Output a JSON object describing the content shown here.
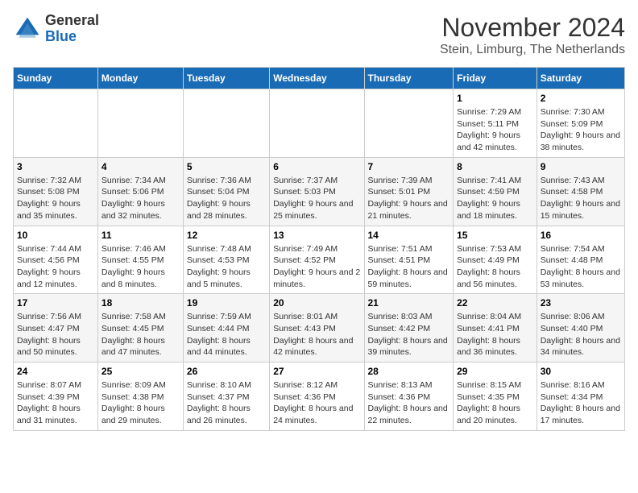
{
  "logo": {
    "line1": "General",
    "line2": "Blue"
  },
  "title": "November 2024",
  "subtitle": "Stein, Limburg, The Netherlands",
  "days_of_week": [
    "Sunday",
    "Monday",
    "Tuesday",
    "Wednesday",
    "Thursday",
    "Friday",
    "Saturday"
  ],
  "weeks": [
    [
      {
        "day": "",
        "info": ""
      },
      {
        "day": "",
        "info": ""
      },
      {
        "day": "",
        "info": ""
      },
      {
        "day": "",
        "info": ""
      },
      {
        "day": "",
        "info": ""
      },
      {
        "day": "1",
        "info": "Sunrise: 7:29 AM\nSunset: 5:11 PM\nDaylight: 9 hours and 42 minutes."
      },
      {
        "day": "2",
        "info": "Sunrise: 7:30 AM\nSunset: 5:09 PM\nDaylight: 9 hours and 38 minutes."
      }
    ],
    [
      {
        "day": "3",
        "info": "Sunrise: 7:32 AM\nSunset: 5:08 PM\nDaylight: 9 hours and 35 minutes."
      },
      {
        "day": "4",
        "info": "Sunrise: 7:34 AM\nSunset: 5:06 PM\nDaylight: 9 hours and 32 minutes."
      },
      {
        "day": "5",
        "info": "Sunrise: 7:36 AM\nSunset: 5:04 PM\nDaylight: 9 hours and 28 minutes."
      },
      {
        "day": "6",
        "info": "Sunrise: 7:37 AM\nSunset: 5:03 PM\nDaylight: 9 hours and 25 minutes."
      },
      {
        "day": "7",
        "info": "Sunrise: 7:39 AM\nSunset: 5:01 PM\nDaylight: 9 hours and 21 minutes."
      },
      {
        "day": "8",
        "info": "Sunrise: 7:41 AM\nSunset: 4:59 PM\nDaylight: 9 hours and 18 minutes."
      },
      {
        "day": "9",
        "info": "Sunrise: 7:43 AM\nSunset: 4:58 PM\nDaylight: 9 hours and 15 minutes."
      }
    ],
    [
      {
        "day": "10",
        "info": "Sunrise: 7:44 AM\nSunset: 4:56 PM\nDaylight: 9 hours and 12 minutes."
      },
      {
        "day": "11",
        "info": "Sunrise: 7:46 AM\nSunset: 4:55 PM\nDaylight: 9 hours and 8 minutes."
      },
      {
        "day": "12",
        "info": "Sunrise: 7:48 AM\nSunset: 4:53 PM\nDaylight: 9 hours and 5 minutes."
      },
      {
        "day": "13",
        "info": "Sunrise: 7:49 AM\nSunset: 4:52 PM\nDaylight: 9 hours and 2 minutes."
      },
      {
        "day": "14",
        "info": "Sunrise: 7:51 AM\nSunset: 4:51 PM\nDaylight: 8 hours and 59 minutes."
      },
      {
        "day": "15",
        "info": "Sunrise: 7:53 AM\nSunset: 4:49 PM\nDaylight: 8 hours and 56 minutes."
      },
      {
        "day": "16",
        "info": "Sunrise: 7:54 AM\nSunset: 4:48 PM\nDaylight: 8 hours and 53 minutes."
      }
    ],
    [
      {
        "day": "17",
        "info": "Sunrise: 7:56 AM\nSunset: 4:47 PM\nDaylight: 8 hours and 50 minutes."
      },
      {
        "day": "18",
        "info": "Sunrise: 7:58 AM\nSunset: 4:45 PM\nDaylight: 8 hours and 47 minutes."
      },
      {
        "day": "19",
        "info": "Sunrise: 7:59 AM\nSunset: 4:44 PM\nDaylight: 8 hours and 44 minutes."
      },
      {
        "day": "20",
        "info": "Sunrise: 8:01 AM\nSunset: 4:43 PM\nDaylight: 8 hours and 42 minutes."
      },
      {
        "day": "21",
        "info": "Sunrise: 8:03 AM\nSunset: 4:42 PM\nDaylight: 8 hours and 39 minutes."
      },
      {
        "day": "22",
        "info": "Sunrise: 8:04 AM\nSunset: 4:41 PM\nDaylight: 8 hours and 36 minutes."
      },
      {
        "day": "23",
        "info": "Sunrise: 8:06 AM\nSunset: 4:40 PM\nDaylight: 8 hours and 34 minutes."
      }
    ],
    [
      {
        "day": "24",
        "info": "Sunrise: 8:07 AM\nSunset: 4:39 PM\nDaylight: 8 hours and 31 minutes."
      },
      {
        "day": "25",
        "info": "Sunrise: 8:09 AM\nSunset: 4:38 PM\nDaylight: 8 hours and 29 minutes."
      },
      {
        "day": "26",
        "info": "Sunrise: 8:10 AM\nSunset: 4:37 PM\nDaylight: 8 hours and 26 minutes."
      },
      {
        "day": "27",
        "info": "Sunrise: 8:12 AM\nSunset: 4:36 PM\nDaylight: 8 hours and 24 minutes."
      },
      {
        "day": "28",
        "info": "Sunrise: 8:13 AM\nSunset: 4:36 PM\nDaylight: 8 hours and 22 minutes."
      },
      {
        "day": "29",
        "info": "Sunrise: 8:15 AM\nSunset: 4:35 PM\nDaylight: 8 hours and 20 minutes."
      },
      {
        "day": "30",
        "info": "Sunrise: 8:16 AM\nSunset: 4:34 PM\nDaylight: 8 hours and 17 minutes."
      }
    ]
  ]
}
